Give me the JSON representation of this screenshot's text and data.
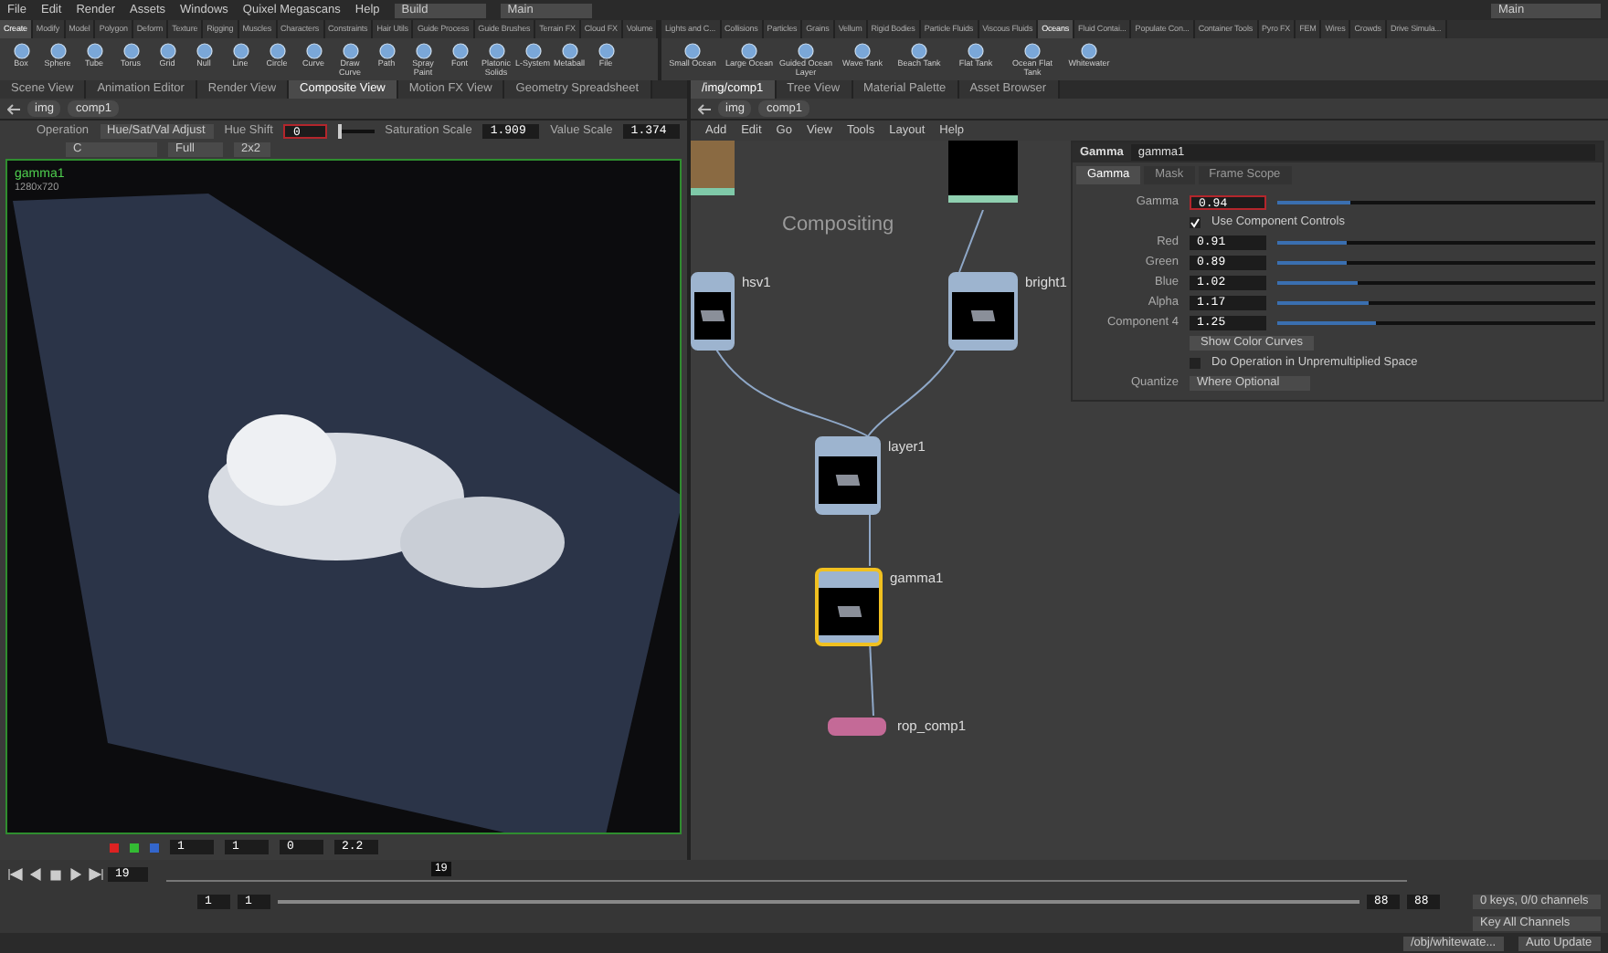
{
  "menu": [
    "File",
    "Edit",
    "Render",
    "Assets",
    "Windows",
    "Quixel Megascans",
    "Help"
  ],
  "desktop": "Build",
  "desktop_name": "Main",
  "right_desktop": "Main",
  "shelf_left": {
    "tabs": [
      {
        "label": "Create",
        "selected": true
      },
      {
        "label": "Modify",
        "selected": false
      },
      {
        "label": "Model",
        "selected": false
      },
      {
        "label": "Polygon",
        "selected": false
      },
      {
        "label": "Deform",
        "selected": false
      },
      {
        "label": "Texture",
        "selected": false
      },
      {
        "label": "Rigging",
        "selected": false
      },
      {
        "label": "Muscles",
        "selected": false
      },
      {
        "label": "Characters",
        "selected": false
      },
      {
        "label": "Constraints",
        "selected": false
      },
      {
        "label": "Hair Utils",
        "selected": false
      },
      {
        "label": "Guide Process",
        "selected": false
      },
      {
        "label": "Guide Brushes",
        "selected": false
      },
      {
        "label": "Terrain FX",
        "selected": false
      },
      {
        "label": "Cloud FX",
        "selected": false
      },
      {
        "label": "Volume",
        "selected": false
      }
    ],
    "tools": [
      "Box",
      "Sphere",
      "Tube",
      "Torus",
      "Grid",
      "Null",
      "Line",
      "Circle",
      "Curve",
      "Draw Curve",
      "Path",
      "Spray Paint",
      "Font",
      "Platonic Solids",
      "L-System",
      "Metaball",
      "File"
    ]
  },
  "shelf_right": {
    "tabs": [
      {
        "label": "Lights and C...",
        "selected": false
      },
      {
        "label": "Collisions",
        "selected": false
      },
      {
        "label": "Particles",
        "selected": false
      },
      {
        "label": "Grains",
        "selected": false
      },
      {
        "label": "Vellum",
        "selected": false
      },
      {
        "label": "Rigid Bodies",
        "selected": false
      },
      {
        "label": "Particle Fluids",
        "selected": false
      },
      {
        "label": "Viscous Fluids",
        "selected": false
      },
      {
        "label": "Oceans",
        "selected": true
      },
      {
        "label": "Fluid Contai...",
        "selected": false
      },
      {
        "label": "Populate Con...",
        "selected": false
      },
      {
        "label": "Container Tools",
        "selected": false
      },
      {
        "label": "Pyro FX",
        "selected": false
      },
      {
        "label": "FEM",
        "selected": false
      },
      {
        "label": "Wires",
        "selected": false
      },
      {
        "label": "Crowds",
        "selected": false
      },
      {
        "label": "Drive Simula...",
        "selected": false
      }
    ],
    "tools": [
      "Small Ocean",
      "Large Ocean",
      "Guided Ocean Layer",
      "Wave Tank",
      "Beach Tank",
      "Flat Tank",
      "Ocean Flat Tank",
      "Whitewater"
    ]
  },
  "left_pane": {
    "tabs": [
      {
        "label": "Scene View",
        "selected": false
      },
      {
        "label": "Animation Editor",
        "selected": false
      },
      {
        "label": "Render View",
        "selected": false
      },
      {
        "label": "Composite View",
        "selected": true
      },
      {
        "label": "Motion FX View",
        "selected": false
      },
      {
        "label": "Geometry Spreadsheet",
        "selected": false
      }
    ],
    "path": [
      "img",
      "comp1"
    ],
    "toolbar": {
      "operation_label": "Operation",
      "operation": "Hue/Sat/Val Adjust",
      "hue_label": "Hue Shift",
      "hue_value": "0",
      "hue": {
        "level": 0
      },
      "sat_label": "Saturation Scale",
      "sat_value": "1.909",
      "val_label": "Value Scale",
      "val_value": "1.374"
    },
    "toolbar2": [
      "C",
      "Full",
      "2x2"
    ],
    "overlay": {
      "name": "gamma1",
      "resolution": "1280x720"
    },
    "bottom_fields": [
      "1",
      "1",
      "0",
      "2.2"
    ]
  },
  "right_pane": {
    "tabs": [
      {
        "label": "/img/comp1",
        "selected": true
      },
      {
        "label": "Tree View",
        "selected": false
      },
      {
        "label": "Material Palette",
        "selected": false
      },
      {
        "label": "Asset Browser",
        "selected": false
      }
    ],
    "path": [
      "img",
      "comp1"
    ],
    "menu": [
      "Add",
      "Edit",
      "Go",
      "View",
      "Tools",
      "Layout",
      "Help"
    ],
    "network_box": "Compositing",
    "nodes": [
      {
        "name": "hsv1",
        "selected": false
      },
      {
        "name": "bright1",
        "selected": false
      },
      {
        "name": "layer1",
        "selected": false
      },
      {
        "name": "gamma1",
        "selected": true
      },
      {
        "name": "rop_comp1",
        "selected": false
      }
    ],
    "params": {
      "type": "Gamma",
      "name": "gamma1",
      "tabs": [
        {
          "label": "Gamma",
          "selected": true
        },
        {
          "label": "Mask",
          "selected": false
        },
        {
          "label": "Frame Scope",
          "selected": false
        }
      ],
      "rows": [
        {
          "kind": "slider",
          "label": "Gamma",
          "value": "0.94",
          "level": 0.23
        },
        {
          "kind": "checkbox",
          "label": "Use Component Controls",
          "checked": true
        },
        {
          "kind": "slider",
          "label": "Red",
          "value": "0.91",
          "level": 0.22
        },
        {
          "kind": "slider",
          "label": "Green",
          "value": "0.89",
          "level": 0.22
        },
        {
          "kind": "slider",
          "label": "Blue",
          "value": "1.02",
          "level": 0.25
        },
        {
          "kind": "slider",
          "label": "Alpha",
          "value": "1.17",
          "level": 0.29
        },
        {
          "kind": "slider",
          "label": "Component 4",
          "value": "1.25",
          "level": 0.31
        },
        {
          "kind": "button",
          "label": "Show Color Curves"
        },
        {
          "kind": "checkbox",
          "label": "Do Operation in Unpremultiplied Space",
          "checked": false
        },
        {
          "kind": "menu",
          "label": "Quantize",
          "value": "Where Optional"
        }
      ]
    }
  },
  "timeline": {
    "frame": "19",
    "marker": "19",
    "start": "1",
    "range_start": "1",
    "range_end": "88",
    "end": "88",
    "keys": "0 keys, 0/0 channels",
    "key_all": "Key All Channels"
  },
  "status": {
    "path": "/obj/whitewate...",
    "update": "Auto Update"
  }
}
